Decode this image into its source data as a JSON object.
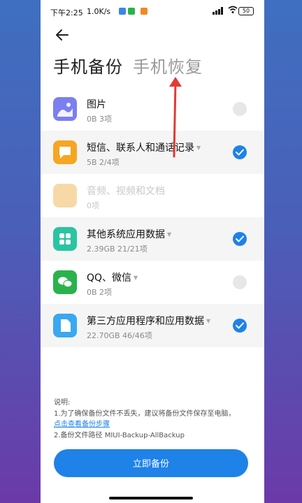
{
  "status_bar": {
    "time": "下午2:25",
    "network_speed": "1.0K/s",
    "notif_icons": [
      "app-icon-blue",
      "wechat-icon",
      "mi-icon"
    ],
    "battery": "50"
  },
  "tabs": {
    "backup": "手机备份",
    "restore": "手机恢复"
  },
  "items": [
    {
      "name": "图片",
      "detail": "0B  3项",
      "checked": false,
      "icon": "photos-icon",
      "icon_color": "#7b7ff0",
      "has_caret": false,
      "disabled": false
    },
    {
      "name": "短信、联系人和通话记录",
      "detail": "5B  2/4项",
      "checked": true,
      "icon": "messages-icon",
      "icon_color": "#f5a623",
      "has_caret": true,
      "disabled": false
    },
    {
      "name": "音频、视频和文档",
      "detail": "0项",
      "checked": false,
      "icon": "folder-icon",
      "icon_color": "#f7d9a8",
      "has_caret": false,
      "disabled": true
    },
    {
      "name": "其他系统应用数据",
      "detail": "2.39GB  21/21项",
      "checked": true,
      "icon": "apps-grid-icon",
      "icon_color": "#2ac4a3",
      "has_caret": true,
      "disabled": false
    },
    {
      "name": "QQ、微信",
      "detail": "0B  2项",
      "checked": false,
      "icon": "wechat-icon",
      "icon_color": "#2bb24c",
      "has_caret": true,
      "disabled": false
    },
    {
      "name": "第三方应用程序和应用数据",
      "detail": "22.70GB  46/46项",
      "checked": true,
      "icon": "document-icon",
      "icon_color": "#3aa8f0",
      "has_caret": true,
      "disabled": false
    }
  ],
  "notes": {
    "heading": "说明:",
    "line1": "1.为了确保备份文件不丢失，建议将备份文件保存至电脑，",
    "link": "点击查看备份步骤",
    "line2": "2.备份文件路径 MIUI-Backup-AllBackup"
  },
  "button": {
    "label": "立即备份"
  },
  "colors": {
    "accent": "#1e82e8",
    "annotation": "#e53935"
  }
}
